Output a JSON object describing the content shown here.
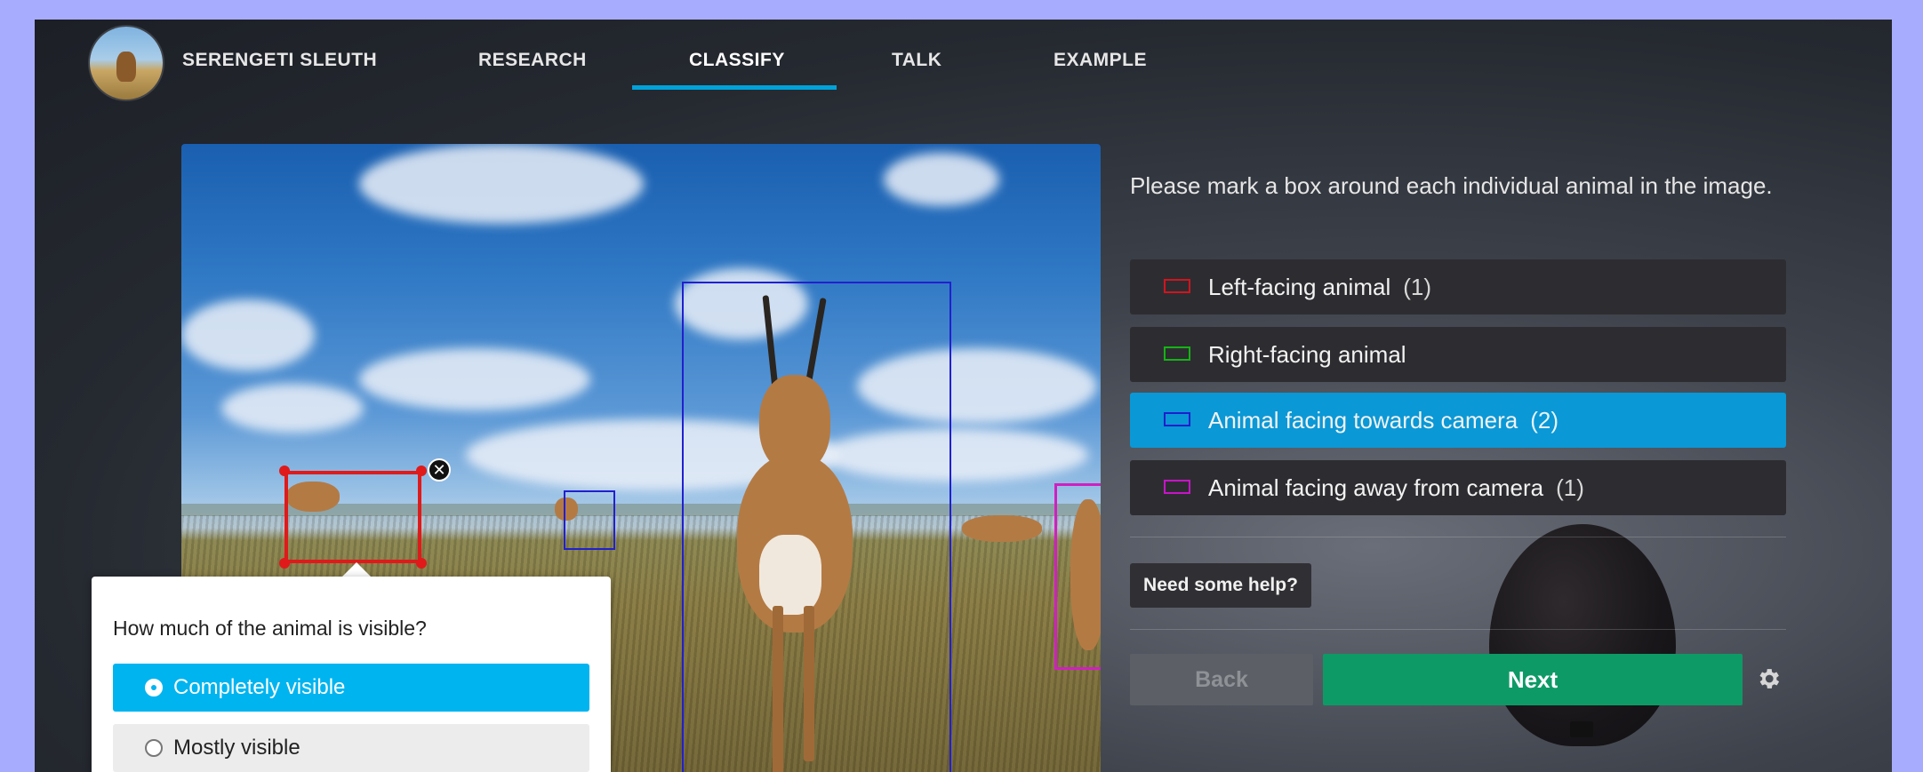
{
  "colors": {
    "frame": "#a8acff",
    "accent": "#00a3d9",
    "next": "#0e9a66",
    "selected_option": "#00b4f0",
    "active_tool": "#0a98d6"
  },
  "nav": {
    "site_title": "SERENGETI SLEUTH",
    "items": [
      {
        "label": "RESEARCH"
      },
      {
        "label": "CLASSIFY",
        "active": true
      },
      {
        "label": "TALK"
      },
      {
        "label": "EXAMPLE"
      }
    ]
  },
  "task": {
    "instructions": "Please mark a box around each individual animal in the image.",
    "tools": [
      {
        "label": "Left-facing animal",
        "count": "(1)",
        "color": "#d2141e"
      },
      {
        "label": "Right-facing animal",
        "count": "",
        "color": "#14b414"
      },
      {
        "label": "Animal facing towards camera",
        "count": "(2)",
        "color": "#1e1ecd",
        "active": true
      },
      {
        "label": "Animal facing away from camera",
        "count": "(1)",
        "color": "#c814c8"
      }
    ],
    "help_label": "Need some help?",
    "back_label": "Back",
    "next_label": "Next"
  },
  "popup": {
    "question": "How much of the animal is visible?",
    "options": [
      {
        "label": "Completely visible",
        "selected": true
      },
      {
        "label": "Mostly visible",
        "selected": false
      }
    ],
    "delete_symbol": "✕"
  },
  "icons": {
    "settings": "gear-icon",
    "delete": "close-icon"
  }
}
